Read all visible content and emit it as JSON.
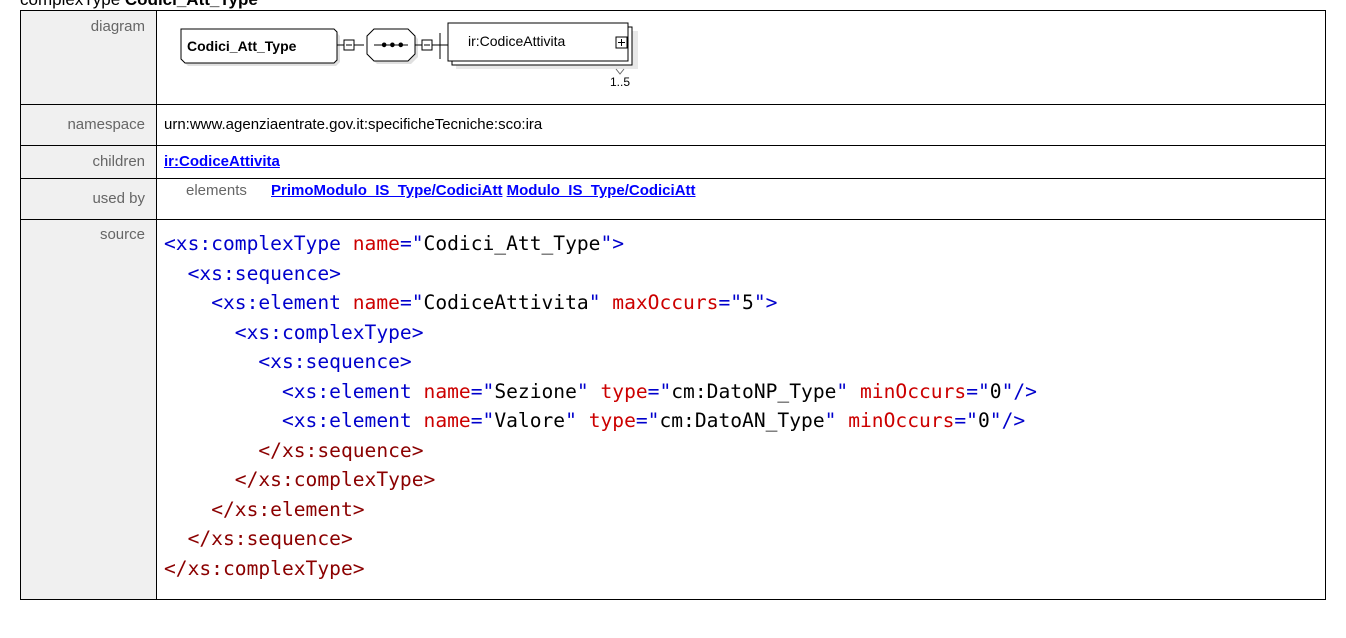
{
  "page": {
    "heading_prefix": "complexType",
    "heading_name": "Codici_Att_Type"
  },
  "rows": {
    "diagram": {
      "label": "diagram"
    },
    "namespace": {
      "label": "namespace",
      "value": "urn:www.agenziaentrate.gov.it:specificheTecniche:sco:ira"
    },
    "children": {
      "label": "children",
      "link": "ir:CodiceAttivita"
    },
    "used_by": {
      "label": "used by",
      "kind": "elements",
      "links": [
        "PrimoModulo_IS_Type/CodiciAtt",
        "Modulo_IS_Type/CodiciAtt"
      ]
    },
    "source": {
      "label": "source"
    }
  },
  "diagram": {
    "type_box": "Codici_Att_Type",
    "sequence_symbol": "•••",
    "element_box": "ir:CodiceAttivita",
    "cardinality": "1..5"
  },
  "source_lines": [
    [
      [
        "t",
        "<xs:complexType "
      ],
      [
        "a",
        "name"
      ],
      [
        "t",
        "=\""
      ],
      [
        "s",
        "Codici_Att_Type"
      ],
      [
        "t",
        "\">"
      ]
    ],
    [
      [
        "s",
        "  "
      ],
      [
        "t",
        "<xs:sequence>"
      ]
    ],
    [
      [
        "s",
        "    "
      ],
      [
        "t",
        "<xs:element "
      ],
      [
        "a",
        "name"
      ],
      [
        "t",
        "=\""
      ],
      [
        "s",
        "CodiceAttivita"
      ],
      [
        "t",
        "\" "
      ],
      [
        "a",
        "maxOccurs"
      ],
      [
        "t",
        "=\""
      ],
      [
        "s",
        "5"
      ],
      [
        "t",
        "\">"
      ]
    ],
    [
      [
        "s",
        "      "
      ],
      [
        "t",
        "<xs:complexType>"
      ]
    ],
    [
      [
        "s",
        "        "
      ],
      [
        "t",
        "<xs:sequence>"
      ]
    ],
    [
      [
        "s",
        "          "
      ],
      [
        "t",
        "<xs:element "
      ],
      [
        "a",
        "name"
      ],
      [
        "t",
        "=\""
      ],
      [
        "s",
        "Sezione"
      ],
      [
        "t",
        "\" "
      ],
      [
        "a",
        "type"
      ],
      [
        "t",
        "=\""
      ],
      [
        "s",
        "cm:DatoNP_Type"
      ],
      [
        "t",
        "\" "
      ],
      [
        "a",
        "minOccurs"
      ],
      [
        "t",
        "=\""
      ],
      [
        "s",
        "0"
      ],
      [
        "t",
        "\"/>"
      ]
    ],
    [
      [
        "s",
        "          "
      ],
      [
        "t",
        "<xs:element "
      ],
      [
        "a",
        "name"
      ],
      [
        "t",
        "=\""
      ],
      [
        "s",
        "Valore"
      ],
      [
        "t",
        "\" "
      ],
      [
        "a",
        "type"
      ],
      [
        "t",
        "=\""
      ],
      [
        "s",
        "cm:DatoAN_Type"
      ],
      [
        "t",
        "\" "
      ],
      [
        "a",
        "minOccurs"
      ],
      [
        "t",
        "=\""
      ],
      [
        "s",
        "0"
      ],
      [
        "t",
        "\"/>"
      ]
    ],
    [
      [
        "s",
        "        "
      ],
      [
        "t",
        "</xs:sequence>"
      ]
    ],
    [
      [
        "s",
        "      "
      ],
      [
        "t",
        "</xs:complexType>"
      ]
    ],
    [
      [
        "s",
        "    "
      ],
      [
        "t",
        "</xs:element>"
      ]
    ],
    [
      [
        "s",
        "  "
      ],
      [
        "t",
        "</xs:sequence>"
      ]
    ],
    [
      [
        "t",
        "</xs:complexType>"
      ]
    ]
  ]
}
